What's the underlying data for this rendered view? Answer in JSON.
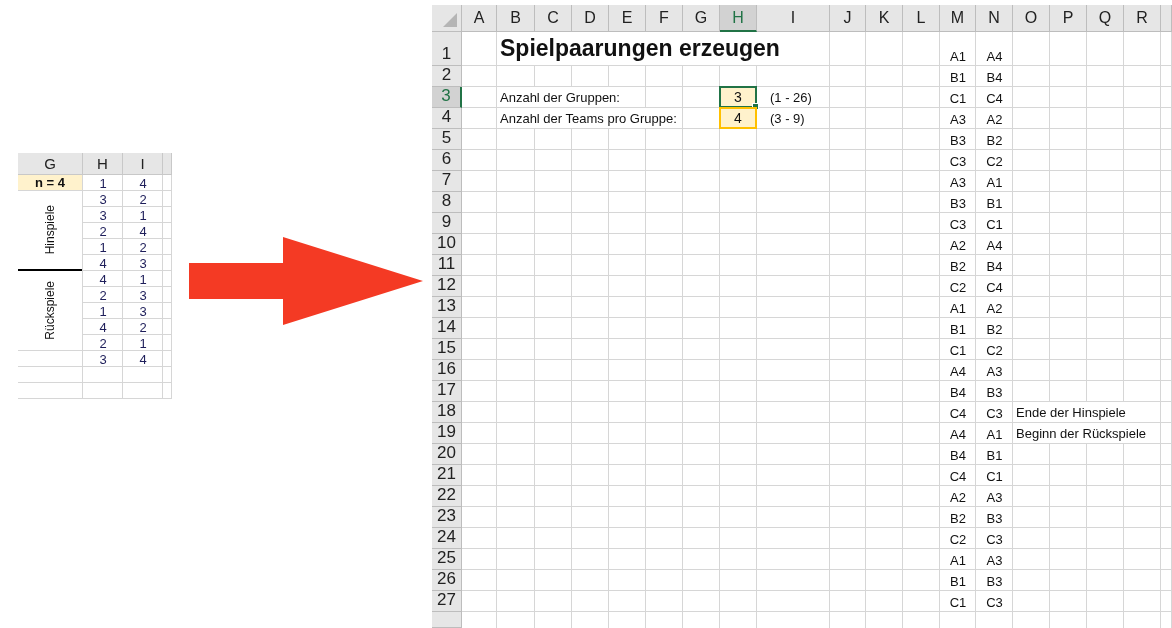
{
  "snippet": {
    "columns": [
      {
        "label": "G"
      },
      {
        "label": "H"
      },
      {
        "label": "I"
      }
    ],
    "header_row": {
      "label": "n = 4",
      "pair": [
        "1",
        "4"
      ]
    },
    "groups": [
      {
        "label": "Hinspiele",
        "pairs": [
          [
            "3",
            "2"
          ],
          [
            "3",
            "1"
          ],
          [
            "2",
            "4"
          ],
          [
            "1",
            "2"
          ],
          [
            "4",
            "3"
          ]
        ]
      },
      {
        "label": "Rückspiele",
        "pairs": [
          [
            "4",
            "1"
          ],
          [
            "2",
            "3"
          ],
          [
            "1",
            "3"
          ],
          [
            "4",
            "2"
          ],
          [
            "2",
            "1"
          ]
        ]
      }
    ],
    "extra_pairs": [
      [
        "3",
        "4"
      ]
    ]
  },
  "sheet": {
    "columns": [
      {
        "label": "A",
        "selected": false
      },
      {
        "label": "B",
        "selected": false
      },
      {
        "label": "C",
        "selected": false
      },
      {
        "label": "D",
        "selected": false
      },
      {
        "label": "E",
        "selected": false
      },
      {
        "label": "F",
        "selected": false
      },
      {
        "label": "G",
        "selected": false
      },
      {
        "label": "H",
        "selected": true
      },
      {
        "label": "I",
        "selected": false
      },
      {
        "label": "J",
        "selected": false
      },
      {
        "label": "K",
        "selected": false
      },
      {
        "label": "L",
        "selected": false
      },
      {
        "label": "M",
        "selected": false
      },
      {
        "label": "N",
        "selected": false
      },
      {
        "label": "O",
        "selected": false
      },
      {
        "label": "P",
        "selected": false
      },
      {
        "label": "Q",
        "selected": false
      },
      {
        "label": "R",
        "selected": false
      }
    ],
    "rows": [
      {
        "label": "1",
        "selected": false,
        "title": "Spielpaarungen erzeugen",
        "pair": [
          "A1",
          "A4"
        ]
      },
      {
        "label": "2",
        "selected": false,
        "pair": [
          "B1",
          "B4"
        ]
      },
      {
        "label": "3",
        "selected": true,
        "input": {
          "label": "Anzahl der Gruppen:",
          "value": "3",
          "selected": true,
          "range": "(1 - 26)"
        },
        "pair": [
          "C1",
          "C4"
        ]
      },
      {
        "label": "4",
        "selected": false,
        "input": {
          "label": "Anzahl der Teams pro Gruppe:",
          "value": "4",
          "selected": false,
          "range": "(3 - 9)"
        },
        "pair": [
          "A3",
          "A2"
        ]
      },
      {
        "label": "5",
        "selected": false,
        "pair": [
          "B3",
          "B2"
        ]
      },
      {
        "label": "6",
        "selected": false,
        "pair": [
          "C3",
          "C2"
        ]
      },
      {
        "label": "7",
        "selected": false,
        "pair": [
          "A3",
          "A1"
        ]
      },
      {
        "label": "8",
        "selected": false,
        "pair": [
          "B3",
          "B1"
        ]
      },
      {
        "label": "9",
        "selected": false,
        "pair": [
          "C3",
          "C1"
        ]
      },
      {
        "label": "10",
        "selected": false,
        "pair": [
          "A2",
          "A4"
        ]
      },
      {
        "label": "11",
        "selected": false,
        "pair": [
          "B2",
          "B4"
        ]
      },
      {
        "label": "12",
        "selected": false,
        "pair": [
          "C2",
          "C4"
        ]
      },
      {
        "label": "13",
        "selected": false,
        "pair": [
          "A1",
          "A2"
        ]
      },
      {
        "label": "14",
        "selected": false,
        "pair": [
          "B1",
          "B2"
        ]
      },
      {
        "label": "15",
        "selected": false,
        "pair": [
          "C1",
          "C2"
        ]
      },
      {
        "label": "16",
        "selected": false,
        "pair": [
          "A4",
          "A3"
        ]
      },
      {
        "label": "17",
        "selected": false,
        "pair": [
          "B4",
          "B3"
        ]
      },
      {
        "label": "18",
        "selected": false,
        "pair": [
          "C4",
          "C3"
        ],
        "note": "Ende der Hinspiele"
      },
      {
        "label": "19",
        "selected": false,
        "pair": [
          "A4",
          "A1"
        ],
        "note": "Beginn der Rückspiele"
      },
      {
        "label": "20",
        "selected": false,
        "pair": [
          "B4",
          "B1"
        ]
      },
      {
        "label": "21",
        "selected": false,
        "pair": [
          "C4",
          "C1"
        ]
      },
      {
        "label": "22",
        "selected": false,
        "pair": [
          "A2",
          "A3"
        ]
      },
      {
        "label": "23",
        "selected": false,
        "pair": [
          "B2",
          "B3"
        ]
      },
      {
        "label": "24",
        "selected": false,
        "pair": [
          "C2",
          "C3"
        ]
      },
      {
        "label": "25",
        "selected": false,
        "pair": [
          "A1",
          "A3"
        ]
      },
      {
        "label": "26",
        "selected": false,
        "pair": [
          "B1",
          "B3"
        ]
      },
      {
        "label": "27",
        "selected": false,
        "pair": [
          "C1",
          "C3"
        ]
      }
    ]
  }
}
